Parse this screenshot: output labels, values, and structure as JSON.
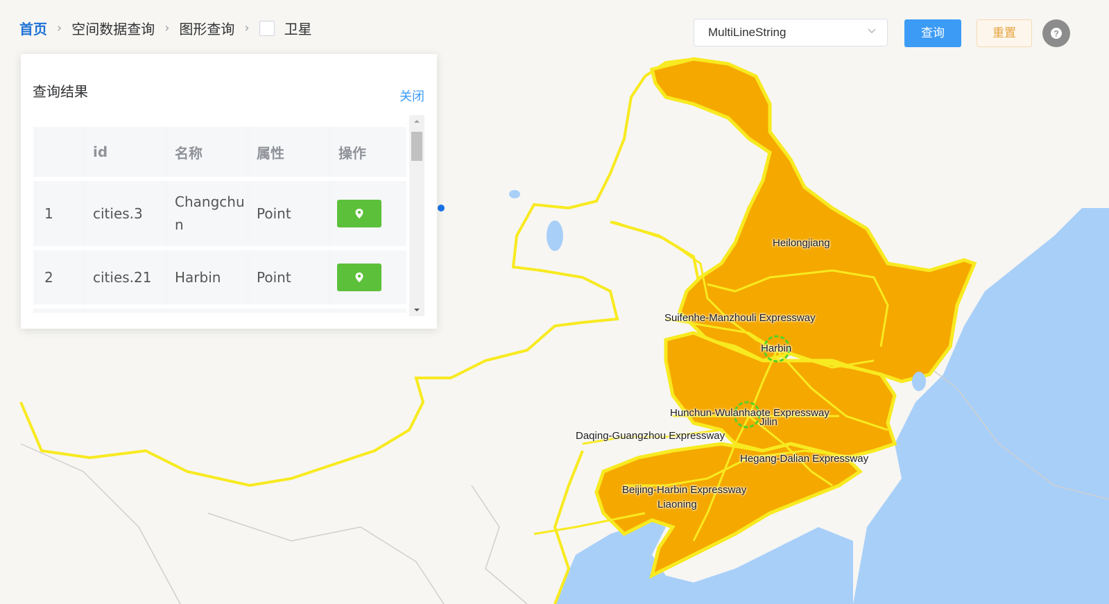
{
  "breadcrumb": {
    "home": "首页",
    "level1": "空间数据查询",
    "level2": "图形查询",
    "satellite_label": "卫星"
  },
  "toolbar": {
    "geometry_select_value": "MultiLineString",
    "query_label": "查询",
    "reset_label": "重置"
  },
  "results_panel": {
    "title": "查询结果",
    "close_label": "关闭",
    "columns": [
      "",
      "id",
      "名称",
      "属性",
      "操作"
    ],
    "rows": [
      {
        "index": "1",
        "id": "cities.3",
        "name": "Changchun",
        "type": "Point"
      },
      {
        "index": "2",
        "id": "cities.21",
        "name": "Harbin",
        "type": "Point"
      }
    ]
  },
  "map": {
    "labels": {
      "heilongjiang": "Heilongjiang",
      "suifenhe": "Suifenhe-Manzhouli Expressway",
      "harbin": "Harbin",
      "hunchun": "Hunchun-Wulanhaote Expressway",
      "jilin": "Jilin",
      "daqing": "Daqing-Guangzhou Expressway",
      "hegang": "Hegang-Dalian Expressway",
      "beijing_harbin": "Beijing-Harbin Expressway",
      "liaoning": "Liaoning"
    },
    "colors": {
      "province_fill": "#f5a800",
      "border_yellow": "#f8ea20",
      "sea": "#a8cff8",
      "land": "#f7f6f3",
      "highlight_ring": "#54d12a"
    }
  },
  "icons": {
    "chevron": "chevron-right-icon",
    "dropdown": "chevron-down-icon",
    "help": "help-icon",
    "locate": "map-pin-icon"
  }
}
